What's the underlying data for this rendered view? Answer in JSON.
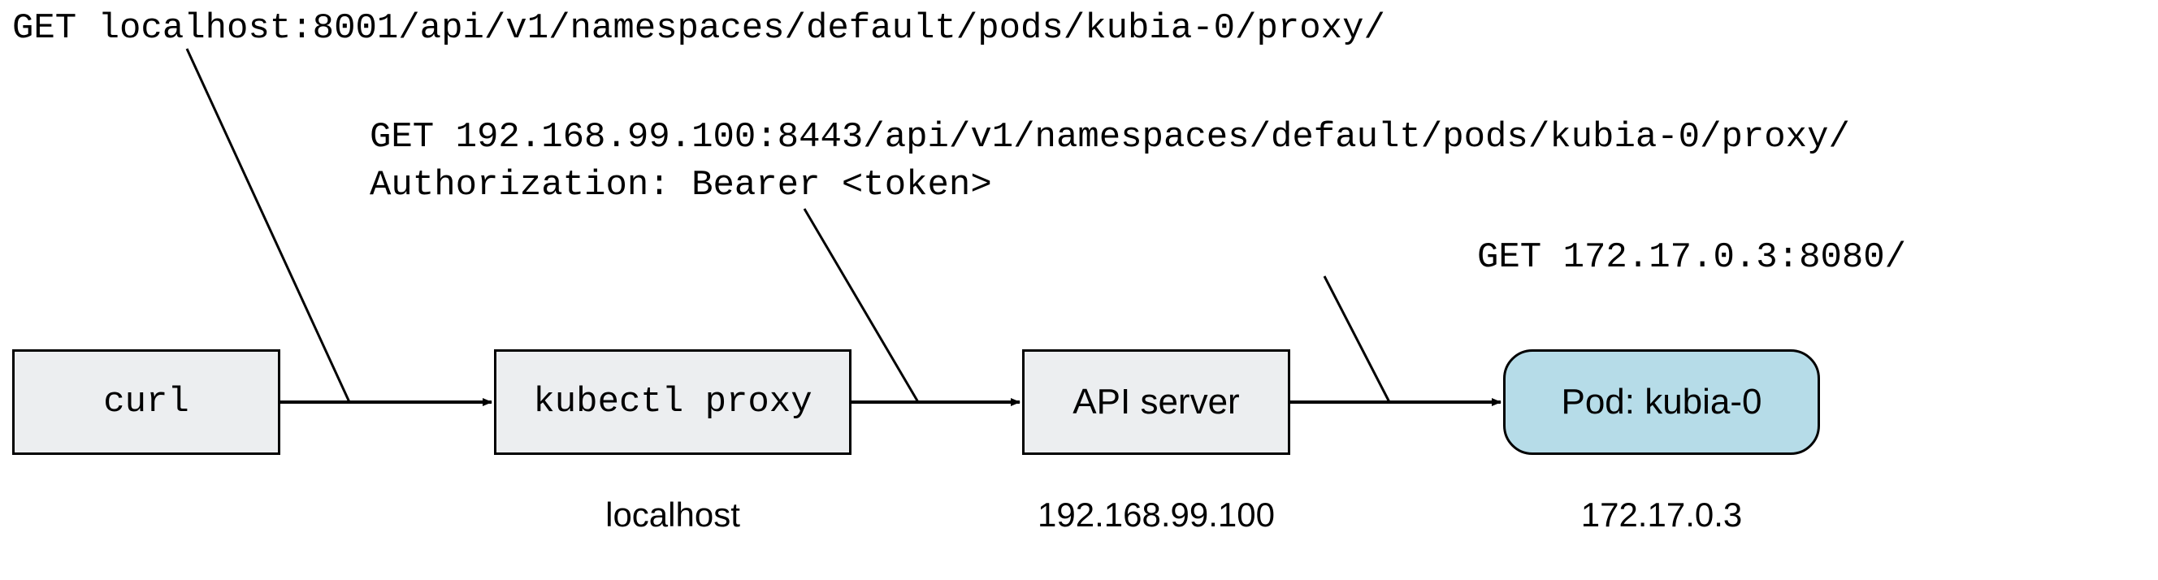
{
  "nodes": {
    "curl": {
      "label": "curl"
    },
    "kubectl_proxy": {
      "label": "kubectl proxy",
      "host": "localhost"
    },
    "api_server": {
      "label": "API server",
      "host": "192.168.99.100"
    },
    "pod": {
      "label": "Pod: kubia-0",
      "host": "172.17.0.3"
    }
  },
  "requests": {
    "req1": {
      "line1": "GET localhost:8001/api/v1/namespaces/default/pods/kubia-0/proxy/"
    },
    "req2": {
      "line1": "GET 192.168.99.100:8443/api/v1/namespaces/default/pods/kubia-0/proxy/",
      "line2": "Authorization: Bearer <token>"
    },
    "req3": {
      "line1": "GET 172.17.0.3:8080/"
    }
  }
}
